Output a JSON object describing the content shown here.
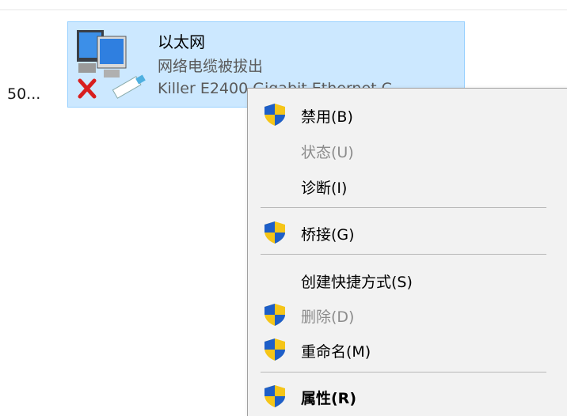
{
  "left_truncated": "50...",
  "adapter": {
    "name": "以太网",
    "status": "网络电缆被拔出",
    "device": "Killer E2400 Gigabit Ethernet C"
  },
  "menu": {
    "items": [
      {
        "label": "禁用(B)",
        "icon": "uac-shield-icon",
        "enabled": true
      },
      {
        "label": "状态(U)",
        "icon": null,
        "enabled": false
      },
      {
        "label": "诊断(I)",
        "icon": null,
        "enabled": true
      },
      {
        "label": "桥接(G)",
        "icon": "uac-shield-icon",
        "enabled": true
      },
      {
        "label": "创建快捷方式(S)",
        "icon": null,
        "enabled": true
      },
      {
        "label": "删除(D)",
        "icon": "uac-shield-icon",
        "enabled": false
      },
      {
        "label": "重命名(M)",
        "icon": "uac-shield-icon",
        "enabled": true
      },
      {
        "label": "属性(R)",
        "icon": "uac-shield-icon",
        "enabled": true,
        "default": true
      }
    ]
  },
  "colors": {
    "selection_bg": "#cce8ff",
    "selection_border": "#99d1ff",
    "menu_bg": "#f2f2f2",
    "disabled_text": "#8c8c8c",
    "shield_blue": "#1e5fc8",
    "shield_yellow": "#f5c518"
  }
}
